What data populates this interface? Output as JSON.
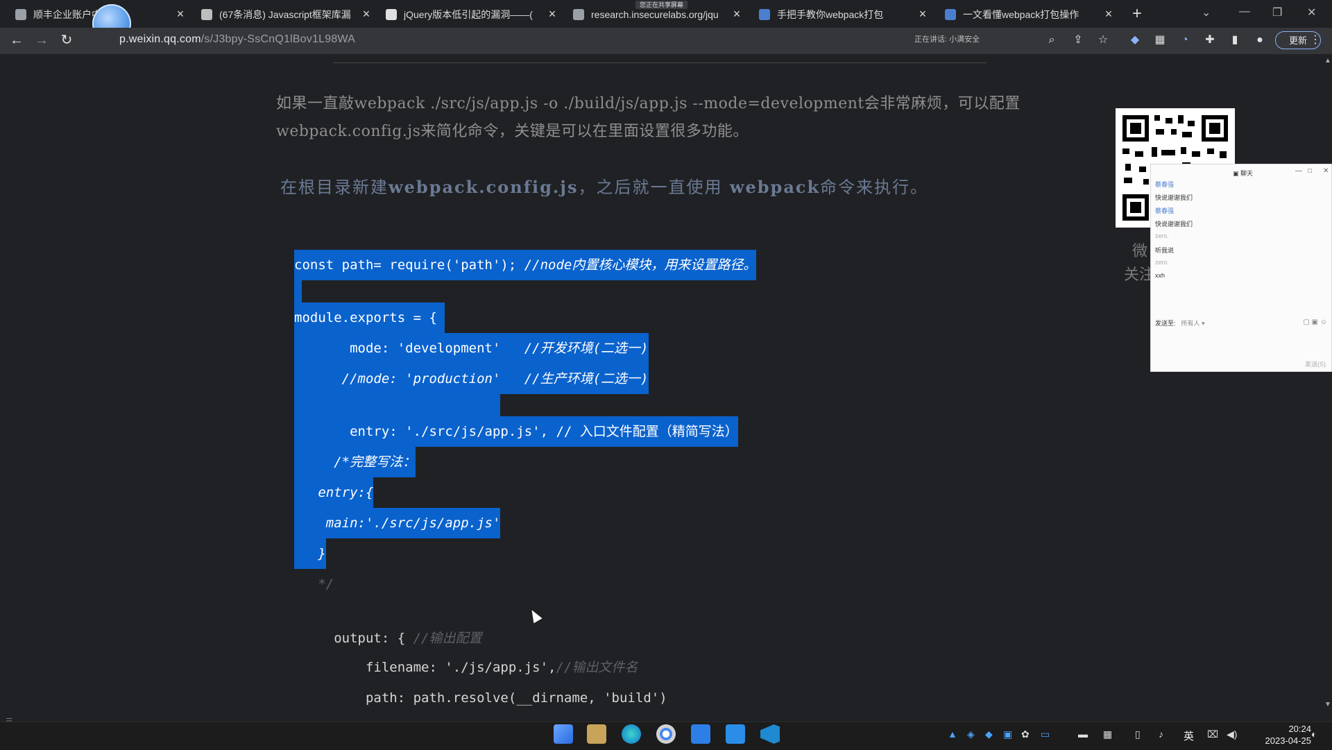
{
  "browser": {
    "tabs": [
      {
        "title": "顺丰企业账户中",
        "favicon_color": "#9aa0a6"
      },
      {
        "title": "(67条消息) Javascript框架库漏",
        "favicon_color": "#bdbdbd"
      },
      {
        "title": "jQuery版本低引起的漏洞——(",
        "favicon_color": "#e0e0e0"
      },
      {
        "title": "research.insecurelabs.org/jqu",
        "favicon_color": "#9aa0a6"
      },
      {
        "title": "手把手教你webpack打包",
        "favicon_color": "#4a7fd0"
      },
      {
        "title": "一文看懂webpack打包操作",
        "favicon_color": "#4a7fd0"
      }
    ],
    "close_glyph": "×",
    "new_tab_glyph": "+",
    "share_indicator": "您正在共享屏幕",
    "url_host": "p.weixin.qq.com",
    "url_path": "/s/J3bpy-SsCnQ1lBov1L98WA",
    "speaking_text": "正在讲话: 小满安全",
    "update_label": "更新"
  },
  "article": {
    "para1": "如果一直敲webpack ./src/js/app.js -o ./build/js/app.js --mode=development会非常麻烦，可以配置webpack.config.js来简化命令，关键是可以在里面设置很多功能。",
    "para2_prefix": "在根目录新建",
    "para2_file": "webpack.config.js",
    "para2_mid": "，之后就一直使用",
    "para2_cmd": " webpack",
    "para2_suffix": "命令来执行。"
  },
  "code_lines": [
    {
      "text": "const path= require('path'); ",
      "comment": "//node内置核心模块，用来设置路径。",
      "style": "sel"
    },
    {
      "text": " ",
      "comment": "",
      "style": "sel"
    },
    {
      "text": "module.exports = { ",
      "comment": "",
      "style": "sel"
    },
    {
      "text": "       mode: 'development'   ",
      "comment": "//开发环境(二选一)",
      "style": "sel"
    },
    {
      "text": "      //mode: 'production'   //生产环境(二选一)",
      "comment": "",
      "style": "sel-italic"
    },
    {
      "text": "                          ",
      "comment": "",
      "style": "sel"
    },
    {
      "text": "       entry: './src/js/app.js', // 入口文件配置（精简写法）",
      "comment": "",
      "style": "sel"
    },
    {
      "text": "     /*完整写法：",
      "comment": "",
      "style": "sel-italic"
    },
    {
      "text": "   entry:{",
      "comment": "",
      "style": "sel-italic"
    },
    {
      "text": "    main:'./src/js/app.js'",
      "comment": "",
      "style": "sel-italic"
    },
    {
      "text": "   }",
      "comment": "",
      "style": "sel-italic"
    },
    {
      "text": "   */",
      "comment": "",
      "style": "dim"
    },
    {
      "text": " ",
      "comment": "",
      "style": "plain"
    },
    {
      "text": "     output: { ",
      "comment": "//输出配置",
      "style": "plain"
    },
    {
      "text": "         filename: './js/app.js',",
      "comment": "//输出文件名",
      "style": "plain"
    },
    {
      "text": "         path: path.resolve(__dirname, 'build')",
      "comment": "",
      "style": "plain"
    }
  ],
  "qr_card": {
    "line1": "微",
    "line2": "关注"
  },
  "chat": {
    "title": "聊天",
    "messages": [
      {
        "name": "蔡春强",
        "text": "快说谢谢我们"
      },
      {
        "name": "蔡春强",
        "text": "快说谢谢我们"
      },
      {
        "name": "zero.",
        "text": "听我说"
      },
      {
        "name": "zero.",
        "text": "xxh"
      }
    ],
    "send_to_label": "发送至:",
    "send_to_value": "所有人 ▾",
    "send_label": "发送(S)"
  },
  "taskbar": {
    "ime": "英",
    "time": "20:24",
    "date": "2023-04-25"
  }
}
